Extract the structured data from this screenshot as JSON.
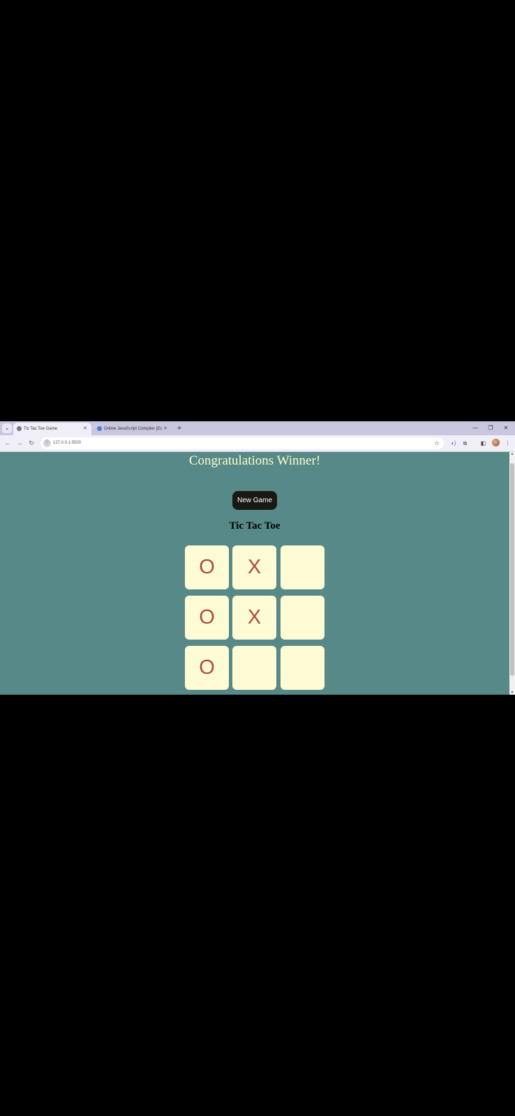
{
  "browser": {
    "tabs": [
      {
        "title": "Tic Tac Toe Game",
        "active": true
      },
      {
        "title": "Online JavaScript Compiler (Ec",
        "active": false
      }
    ],
    "url": "127.0.0.1:5500"
  },
  "page": {
    "message": "Congratulations Winner!",
    "new_game_label": "New Game",
    "title": "Tic Tac Toe"
  },
  "board": {
    "cells": [
      "O",
      "X",
      "",
      "O",
      "X",
      "",
      "O",
      "",
      ""
    ]
  },
  "colors": {
    "background": "#568987",
    "cell": "#fefcd4",
    "mark": "#b0493b",
    "message": "#fffccf",
    "button": "#191913"
  }
}
